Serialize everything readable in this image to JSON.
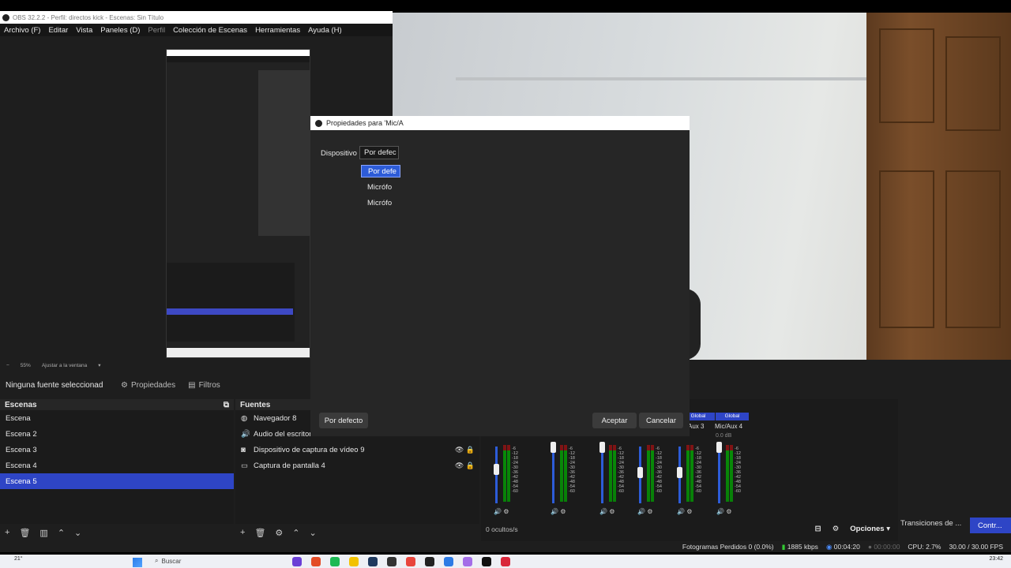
{
  "window": {
    "title": "OBS 32.2.2 - Perfil: directos kick - Escenas: Sin Título"
  },
  "menu": [
    {
      "label": "Archivo (F)",
      "dim": false
    },
    {
      "label": "Editar",
      "dim": false
    },
    {
      "label": "Vista",
      "dim": false
    },
    {
      "label": "Paneles (D)",
      "dim": false
    },
    {
      "label": "Perfil",
      "dim": true
    },
    {
      "label": "Colección de Escenas",
      "dim": false
    },
    {
      "label": "Herramientas",
      "dim": false
    },
    {
      "label": "Ayuda (H)",
      "dim": false
    }
  ],
  "zoom": {
    "value": "55%",
    "fit": "Ajustar a la ventana"
  },
  "dialog": {
    "title": "Propiedades para 'Mic/A",
    "device_label": "Dispositivo",
    "device_value": "Por defec",
    "options": [
      "Por defe",
      "Micrófo",
      "Micrófo"
    ],
    "default_button": "Por defecto",
    "ok_button": "Aceptar",
    "cancel_button": "Cancelar"
  },
  "source_bar": {
    "no_source": "Ninguna fuente seleccionad",
    "properties": "Propiedades",
    "filters": "Filtros"
  },
  "scenes": {
    "header": "Escenas",
    "items": [
      "Escena",
      "Escena 2",
      "Escena 3",
      "Escena 4",
      "Escena 5"
    ],
    "selected_index": 4
  },
  "sources": {
    "header": "Fuentes",
    "items": [
      {
        "label": "Navegador 8",
        "icon": "globe-icon"
      },
      {
        "label": "Audio del escritorio",
        "icon": "speaker-icon"
      },
      {
        "label": "Dispositivo de captura de vídeo 9",
        "icon": "camera-icon"
      },
      {
        "label": "Captura de pantalla 4",
        "icon": "monitor-icon"
      }
    ]
  },
  "mixer": {
    "tabs": [
      "Global",
      "Global"
    ],
    "names": [
      "Aux 3",
      "Mic/Aux 4"
    ],
    "db": "0.0 dB",
    "ticks": [
      "-6",
      "-12",
      "-18",
      "-24",
      "-30",
      "-36",
      "-42",
      "-48",
      "-54",
      "-60"
    ],
    "hidden": "0 ocultos/s",
    "options": "Opciones",
    "colors": {
      "accent": "#2e45c6",
      "meter_green": "#00b000",
      "meter_red": "#aa1111"
    }
  },
  "transitions": {
    "label": "Transiciones de ...",
    "controls": "Contr..."
  },
  "status": {
    "dropped": "Fotogramas Perdidos 0 (0.0%)",
    "bitrate": "1885 kbps",
    "live_time": "00:04:20",
    "rec_time": "00:00:00",
    "cpu": "CPU: 2.7%",
    "fps": "30.00 / 30.00 FPS"
  },
  "taskbar": {
    "search": "Buscar",
    "temp": "21°",
    "time": "23:42"
  }
}
